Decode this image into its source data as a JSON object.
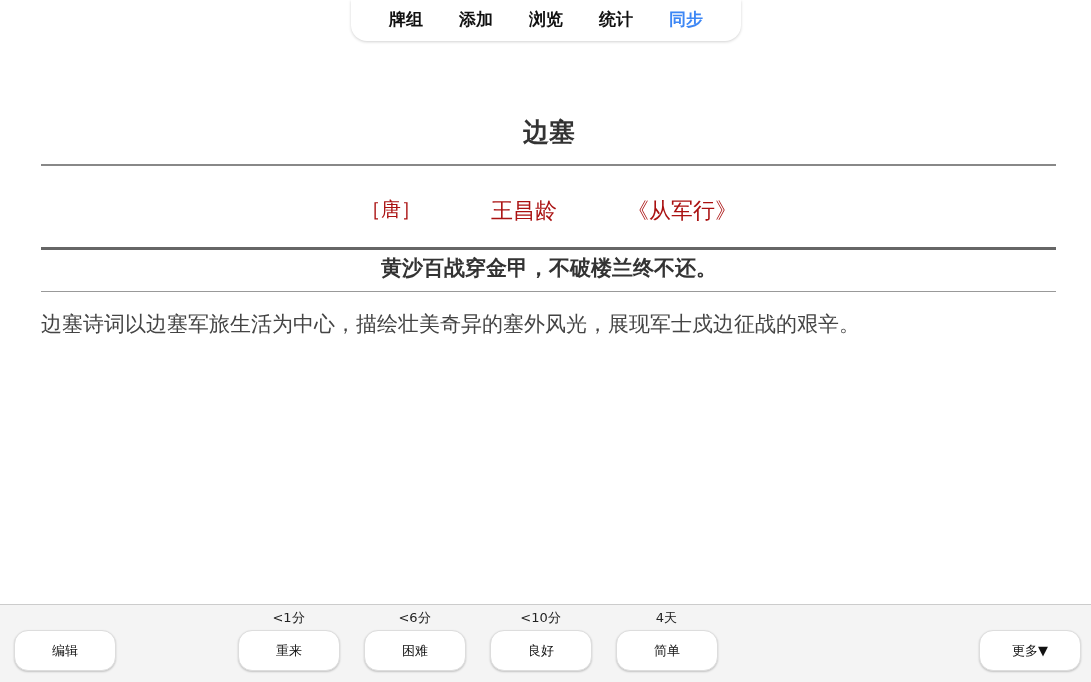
{
  "tabs": [
    {
      "label": "牌组",
      "selected": false
    },
    {
      "label": "添加",
      "selected": false
    },
    {
      "label": "浏览",
      "selected": false
    },
    {
      "label": "统计",
      "selected": false
    },
    {
      "label": "同步",
      "selected": true
    }
  ],
  "card": {
    "title": "边塞",
    "dynasty": "［唐］",
    "author": "王昌龄",
    "poem": "《从军行》",
    "verse": "黄沙百战穿金甲，不破楼兰终不还。",
    "description": "边塞诗词以边塞军旅生活为中心，描绘壮美奇异的塞外风光，展现军士戍边征战的艰辛。"
  },
  "bottom_bar": {
    "edit_button": "编辑",
    "answers": [
      {
        "interval": "<1分",
        "label": "重来"
      },
      {
        "interval": "<6分",
        "label": "困难"
      },
      {
        "interval": "<10分",
        "label": "良好"
      },
      {
        "interval": "4天",
        "label": "简单"
      }
    ],
    "more_button": "更多▼"
  }
}
